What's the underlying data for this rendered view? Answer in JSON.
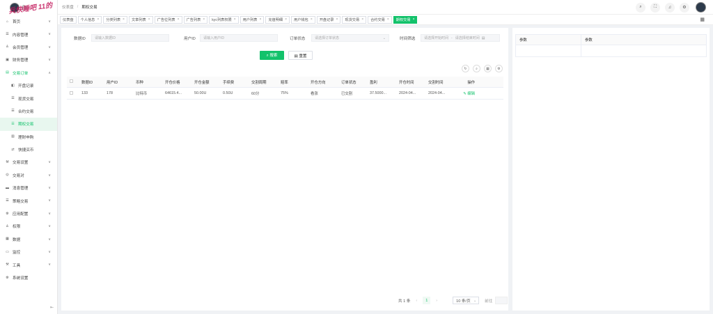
{
  "app": {
    "logo_text": "你",
    "watermark": "兵快睡吧 11的"
  },
  "sidebar": {
    "items": [
      {
        "icon": "home-icon",
        "glyph": "⌂",
        "label": "首页",
        "chevron": "∨"
      },
      {
        "icon": "list-icon",
        "glyph": "☰",
        "label": "内容管理",
        "chevron": "∨"
      },
      {
        "icon": "user-icon",
        "glyph": "♙",
        "label": "会员管理",
        "chevron": "∨"
      },
      {
        "icon": "finance-icon",
        "glyph": "▣",
        "label": "财务管理",
        "chevron": "∨"
      },
      {
        "icon": "orders-icon",
        "glyph": "▤",
        "label": "交易订单",
        "chevron": "∧",
        "open": true
      },
      {
        "icon": "record-icon",
        "glyph": "◧",
        "label": "开盘记录",
        "sub": true
      },
      {
        "icon": "list-icon",
        "glyph": "☰",
        "label": "现货交易",
        "sub": true
      },
      {
        "icon": "list-icon",
        "glyph": "☰",
        "label": "合约交易",
        "sub": true
      },
      {
        "icon": "list-icon",
        "glyph": "☰",
        "label": "期权交易",
        "sub": true,
        "active": true
      },
      {
        "icon": "finance-icon",
        "glyph": "▥",
        "label": "理财申购",
        "sub": true
      },
      {
        "icon": "exchange-icon",
        "glyph": "⇄",
        "label": "快捷买币",
        "sub": true
      },
      {
        "icon": "tool-icon",
        "glyph": "⚒",
        "label": "交易设置",
        "chevron": "∨"
      },
      {
        "icon": "pair-icon",
        "glyph": "◎",
        "label": "交易对",
        "chevron": "∨"
      },
      {
        "icon": "message-icon",
        "glyph": "▬",
        "label": "消息管理",
        "chevron": "∨"
      },
      {
        "icon": "strategy-icon",
        "glyph": "☰",
        "label": "策略交易",
        "chevron": "∨"
      },
      {
        "icon": "config-icon",
        "glyph": "⚙",
        "label": "应用配置",
        "chevron": "∨"
      },
      {
        "icon": "permission-icon",
        "glyph": "♙",
        "label": "权限",
        "chevron": "∨"
      },
      {
        "icon": "data-icon",
        "glyph": "▦",
        "label": "数据",
        "chevron": "∨"
      },
      {
        "icon": "monitor-icon",
        "glyph": "▭",
        "label": "监控",
        "chevron": "∨"
      },
      {
        "icon": "tools-icon",
        "glyph": "⚒",
        "label": "工具",
        "chevron": "∨"
      },
      {
        "icon": "settings-icon",
        "glyph": "⚙",
        "label": "系统设置"
      }
    ],
    "collapse_glyph": "⇤"
  },
  "header": {
    "breadcrumb": [
      "仪表盘",
      "期权交易"
    ],
    "separator": "/",
    "tools": [
      {
        "icon": "search-icon",
        "glyph": "⌕"
      },
      {
        "icon": "fullscreen-icon",
        "glyph": "⛶"
      },
      {
        "icon": "bell-icon",
        "glyph": "♫"
      },
      {
        "icon": "gear-icon",
        "glyph": "⚙"
      }
    ]
  },
  "tabs": [
    {
      "label": "仪表盘",
      "closable": false
    },
    {
      "label": "个人信息",
      "closable": true
    },
    {
      "label": "分类列表",
      "closable": true
    },
    {
      "label": "文章列表",
      "closable": true
    },
    {
      "label": "广告位列表",
      "closable": true
    },
    {
      "label": "广告列表",
      "closable": true
    },
    {
      "label": "kyc列表权限",
      "closable": true
    },
    {
      "label": "用户列表",
      "closable": true
    },
    {
      "label": "充值明细",
      "closable": true
    },
    {
      "label": "用户钱包",
      "closable": true
    },
    {
      "label": "开盘记录",
      "closable": true
    },
    {
      "label": "现货交易",
      "closable": true
    },
    {
      "label": "合约交易",
      "closable": true
    },
    {
      "label": "期权交易",
      "closable": true,
      "active": true
    }
  ],
  "tab_close_glyph": "×",
  "tab_menu_glyph": "▦",
  "filters": {
    "data_id": {
      "label": "数据ID",
      "placeholder": "请输入数据ID"
    },
    "user_id": {
      "label": "用户ID",
      "placeholder": "请输入用户ID"
    },
    "order_status": {
      "label": "订单状态",
      "placeholder": "请选择订单状态",
      "dd": "⌄"
    },
    "time": {
      "label": "时间筛选",
      "start_placeholder": "请选择开始时间",
      "dash": "-",
      "end_placeholder": "请选择结束时间",
      "cal": "▤"
    },
    "search_label": "⌕ 搜索",
    "reset_label": "▤ 重置"
  },
  "table_tools": [
    {
      "icon": "refresh-icon",
      "glyph": "↻"
    },
    {
      "icon": "search-icon",
      "glyph": "⌕"
    },
    {
      "icon": "columns-icon",
      "glyph": "▦"
    },
    {
      "icon": "settings-icon",
      "glyph": "⚙"
    }
  ],
  "table": {
    "columns": [
      "数据ID",
      "用户ID",
      "币种",
      "开仓价格",
      "开仓金额",
      "手续费",
      "交割周期",
      "赔率",
      "开仓方向",
      "订单状态",
      "盈利",
      "开仓时间",
      "交割时间",
      "操作"
    ],
    "rows": [
      [
        "133",
        "178",
        "比特币",
        "64615.4...",
        "50.00U",
        "0.50U",
        "60分",
        "75%",
        "看涨",
        "已交割",
        "37.5000...",
        "2024-04...",
        "2024-04...",
        "✎ 编辑"
      ]
    ]
  },
  "pager": {
    "total": "共 1 条",
    "prev": "‹",
    "page": "1",
    "next": "›",
    "size": "10 条/页",
    "size_dd": "⌄",
    "goto": "前往"
  },
  "side_table": {
    "columns": [
      "参数",
      "参数"
    ]
  }
}
